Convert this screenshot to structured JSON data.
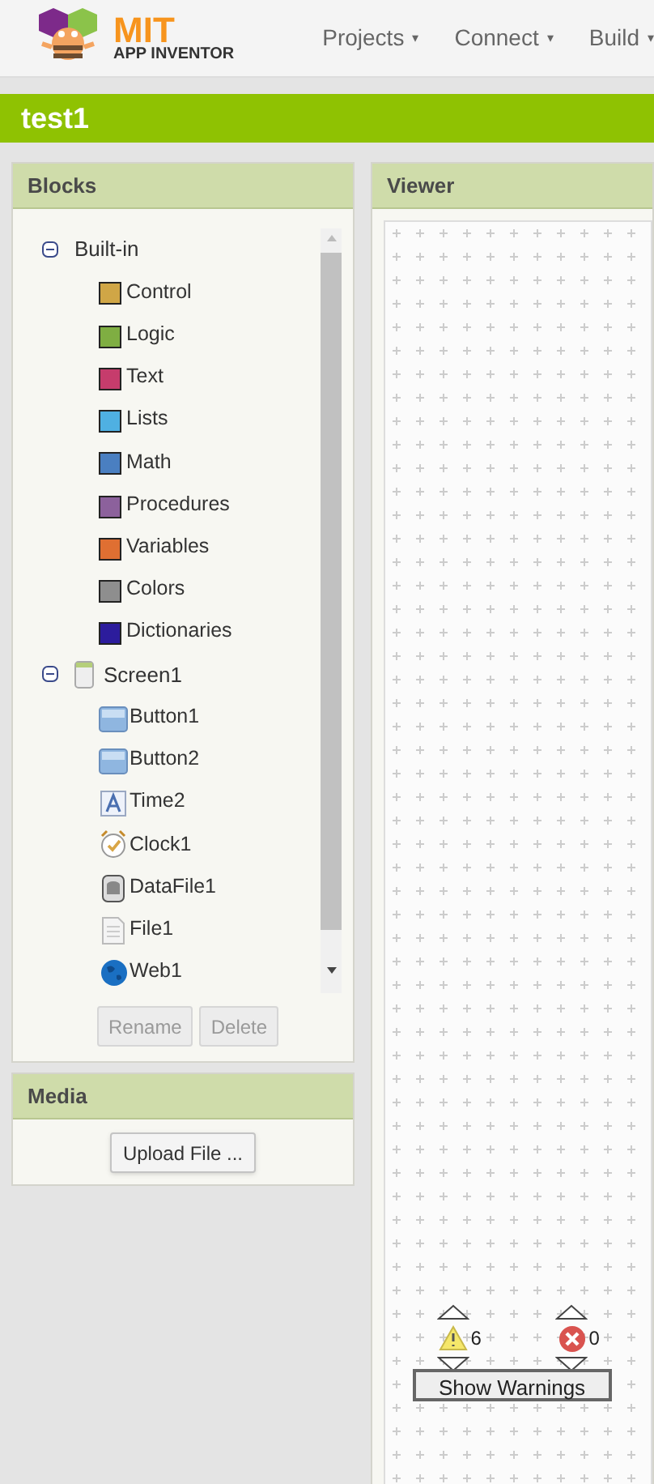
{
  "logo": {
    "title": "MIT",
    "subtitle": "APP INVENTOR"
  },
  "menu": [
    {
      "label": "Projects",
      "caret": "▾"
    },
    {
      "label": "Connect",
      "caret": "▾"
    },
    {
      "label": "Build",
      "caret": "▾"
    }
  ],
  "project_title": "test1",
  "blocks_panel": {
    "title": "Blocks",
    "tree": [
      {
        "label": "Built-in",
        "kind": "group",
        "expanded": true,
        "children": [
          {
            "label": "Control",
            "kind": "category",
            "color": "#d0a646"
          },
          {
            "label": "Logic",
            "kind": "category",
            "color": "#7fae42"
          },
          {
            "label": "Text",
            "kind": "category",
            "color": "#c63c6c"
          },
          {
            "label": "Lists",
            "kind": "category",
            "color": "#4fb0e2"
          },
          {
            "label": "Math",
            "kind": "category",
            "color": "#4a7fc1"
          },
          {
            "label": "Procedures",
            "kind": "category",
            "color": "#8c619c"
          },
          {
            "label": "Variables",
            "kind": "category",
            "color": "#df6f32"
          },
          {
            "label": "Colors",
            "kind": "category",
            "color": "#8e8e8e"
          },
          {
            "label": "Dictionaries",
            "kind": "category",
            "color": "#2c1c9c"
          }
        ]
      },
      {
        "label": "Screen1",
        "kind": "screen",
        "expanded": true,
        "children": [
          {
            "label": "Button1",
            "kind": "button"
          },
          {
            "label": "Button2",
            "kind": "button"
          },
          {
            "label": "Time2",
            "kind": "label"
          },
          {
            "label": "Clock1",
            "kind": "clock"
          },
          {
            "label": "DataFile1",
            "kind": "datafile"
          },
          {
            "label": "File1",
            "kind": "file"
          },
          {
            "label": "Web1",
            "kind": "web"
          }
        ]
      }
    ],
    "buttons": [
      {
        "label": "Rename",
        "disabled": true
      },
      {
        "label": "Delete",
        "disabled": true
      }
    ]
  },
  "media_panel": {
    "title": "Media",
    "button": "Upload File ..."
  },
  "viewer": {
    "title": "Viewer",
    "warning_count": "6",
    "error_count": "0",
    "button": "Show Warnings"
  }
}
